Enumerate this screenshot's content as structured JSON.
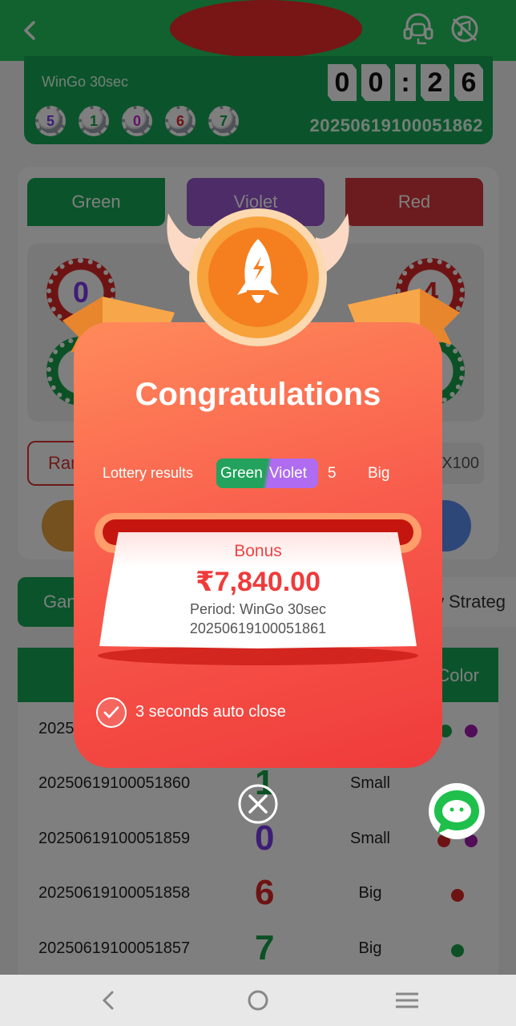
{
  "header": {
    "game_name": "WinGo 30sec",
    "timer": [
      "0",
      "0",
      ":",
      "2",
      "6"
    ],
    "current_period": "20250619100051862",
    "last_results": [
      {
        "num": "5",
        "color": "#7c3aed"
      },
      {
        "num": "1",
        "color": "#16a34a"
      },
      {
        "num": "0",
        "color": "#c026d3"
      },
      {
        "num": "6",
        "color": "#dc2626"
      },
      {
        "num": "7",
        "color": "#16a34a"
      }
    ]
  },
  "bet": {
    "green_label": "Green",
    "violet_label": "Violet",
    "red_label": "Red",
    "ball_0": "0",
    "ball_4": "4",
    "random_label": "Ran",
    "multiplier_label": "X100"
  },
  "tabs": {
    "game_history": "Gan",
    "strategy": "w Strateg"
  },
  "history": {
    "color_col": "Color",
    "rows": [
      {
        "period": "2025",
        "num": "",
        "size": "",
        "num_color": "#16a34a",
        "dots": [
          "#16a34a",
          "#a21caf"
        ]
      },
      {
        "period": "20250619100051860",
        "num": "1",
        "size": "Small",
        "num_color": "#16a34a",
        "dots": []
      },
      {
        "period": "20250619100051859",
        "num": "0",
        "size": "Small",
        "num_color": "#7c3aed",
        "dots": [
          "#dc2626",
          "#a21caf"
        ]
      },
      {
        "period": "20250619100051858",
        "num": "6",
        "size": "Big",
        "num_color": "#dc2626",
        "dots": [
          "#dc2626"
        ]
      },
      {
        "period": "20250619100051857",
        "num": "7",
        "size": "Big",
        "num_color": "#16a34a",
        "dots": [
          "#16a34a"
        ]
      }
    ]
  },
  "popup": {
    "title": "Congratulations",
    "lottery_label": "Lottery results",
    "result_green": "Green",
    "result_violet": "Violet",
    "result_number": "5",
    "result_size": "Big",
    "bonus_label": "Bonus",
    "bonus_amount": "₹7,840.00",
    "period_text": "Period: WinGo 30sec",
    "period_number": "20250619100051861",
    "auto_close": "3 seconds auto close"
  },
  "icons": {
    "back": "chevron-left-icon",
    "support": "headset-icon",
    "sound": "sound-off-icon",
    "close": "close-circle-icon",
    "chat": "chat-bubble-icon"
  },
  "colors": {
    "brand_green": "#17a956",
    "violet": "#9b59d0",
    "red": "#d9383e",
    "popup_red": "#ef3b3b"
  }
}
